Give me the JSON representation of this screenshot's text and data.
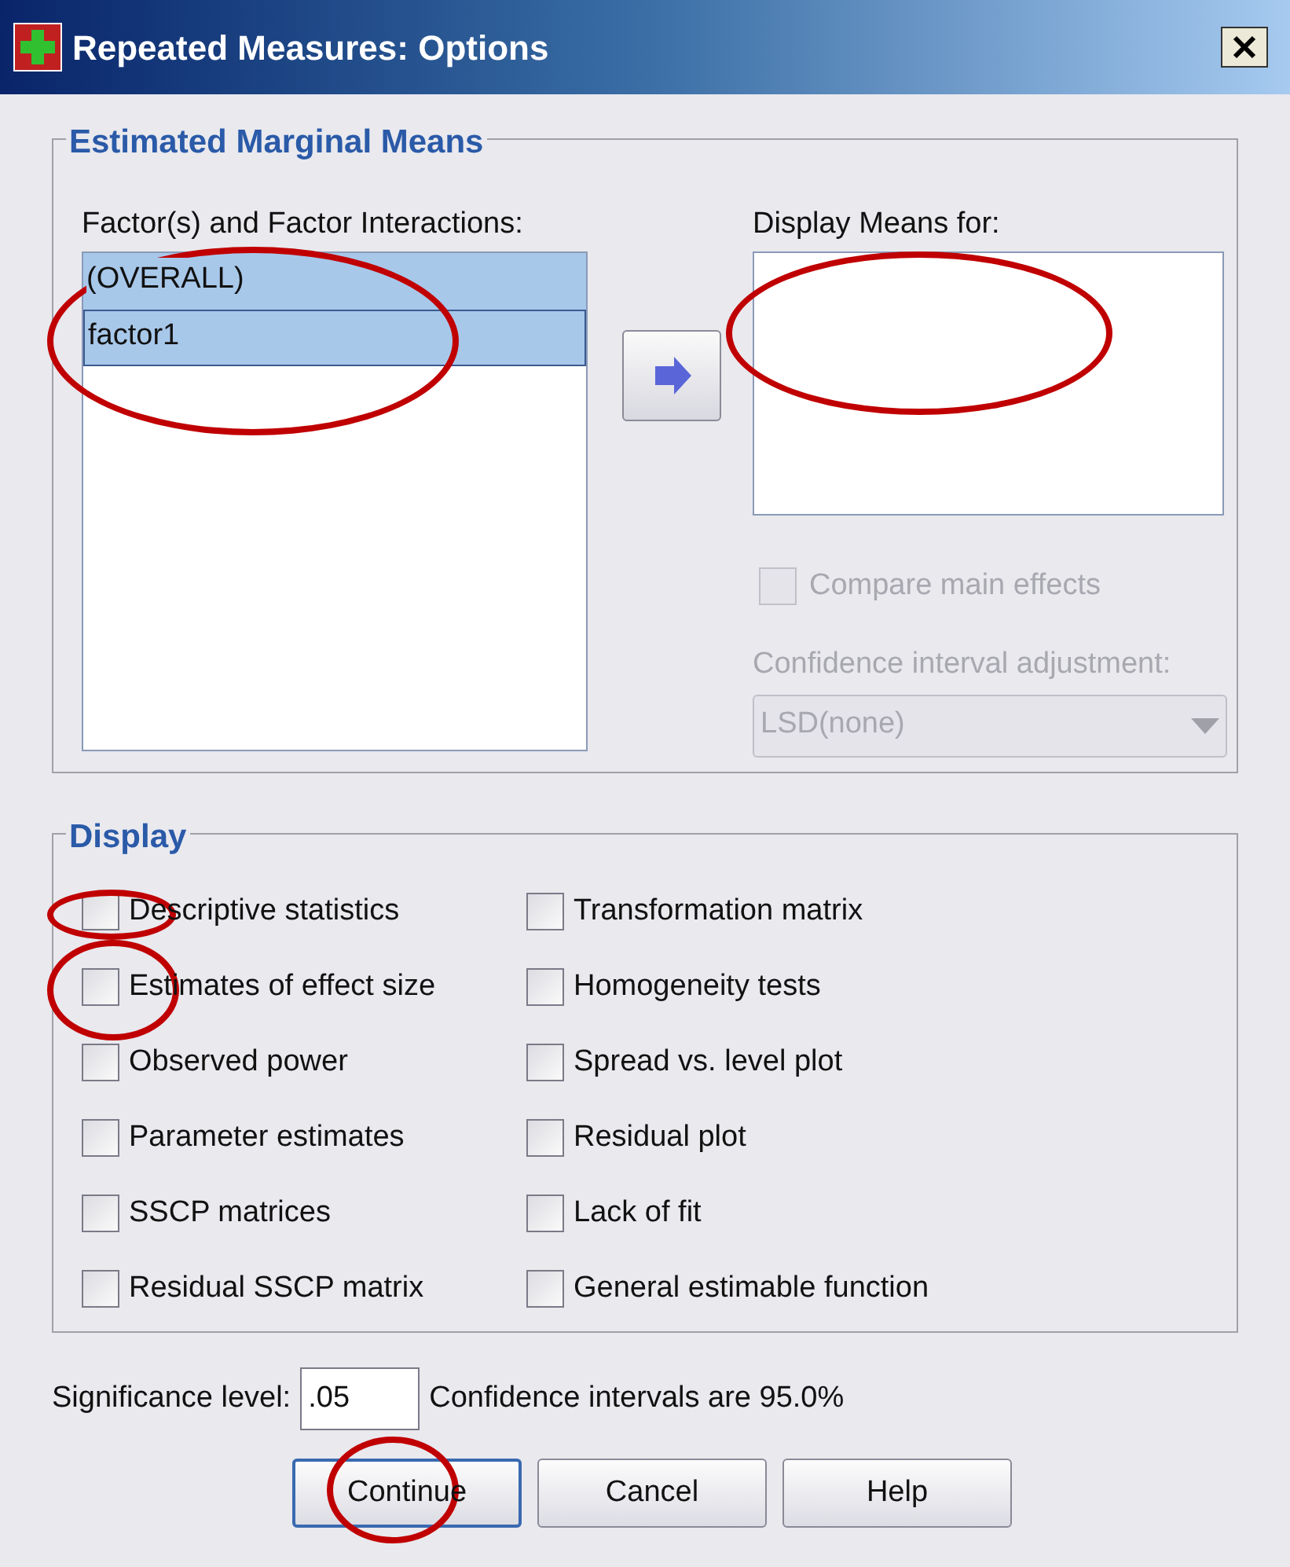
{
  "window": {
    "title": "Repeated Measures: Options"
  },
  "emm": {
    "title": "Estimated Marginal Means",
    "factors_label": "Factor(s) and Factor Interactions:",
    "factors": [
      {
        "label": "(OVERALL)",
        "selected": true
      },
      {
        "label": "factor1",
        "selected": true
      }
    ],
    "factors_highlighted": true,
    "display_label": "Display Means for:",
    "display_highlighted": true,
    "compare": {
      "label": "Compare main effects",
      "checked": false,
      "disabled": true
    },
    "ci_label": "Confidence interval adjustment:",
    "ci_value": "LSD(none)",
    "ci_disabled": true
  },
  "display": {
    "title": "Display",
    "options": [
      {
        "label": "Descriptive statistics",
        "checked": false,
        "highlighted": true
      },
      {
        "label": "Transformation matrix",
        "checked": false,
        "highlighted": false
      },
      {
        "label": "Estimates of effect size",
        "checked": false,
        "highlighted": true
      },
      {
        "label": "Homogeneity tests",
        "checked": false,
        "highlighted": false
      },
      {
        "label": "Observed power",
        "checked": false,
        "highlighted": false
      },
      {
        "label": "Spread vs. level plot",
        "checked": false,
        "highlighted": false
      },
      {
        "label": "Parameter estimates",
        "checked": false,
        "highlighted": false
      },
      {
        "label": "Residual plot",
        "checked": false,
        "highlighted": false
      },
      {
        "label": "SSCP matrices",
        "checked": false,
        "highlighted": false
      },
      {
        "label": "Lack of fit",
        "checked": false,
        "highlighted": false
      },
      {
        "label": "Residual SSCP matrix",
        "checked": false,
        "highlighted": false
      },
      {
        "label": "General estimable function",
        "checked": false,
        "highlighted": false
      }
    ]
  },
  "significance": {
    "label": "Significance level:",
    "value": ".05",
    "note": "Confidence intervals are 95.0%"
  },
  "buttons": [
    {
      "label": "Continue",
      "highlighted": true
    },
    {
      "label": "Cancel",
      "highlighted": false
    },
    {
      "label": "Help",
      "highlighted": false
    }
  ]
}
